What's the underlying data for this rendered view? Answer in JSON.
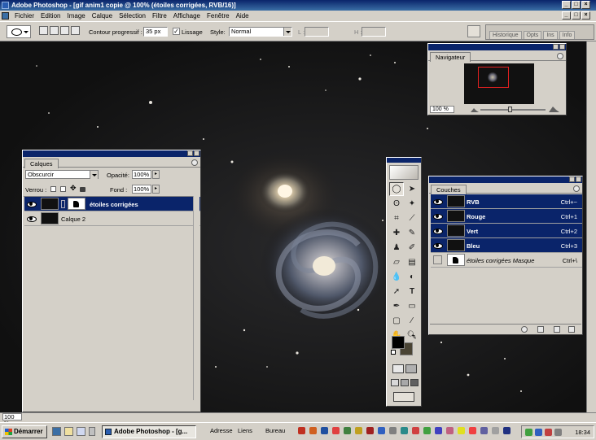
{
  "window": {
    "title": "Adobe Photoshop - [gif anim1 copie @ 100% (étoiles corrigées, RVB/16)]"
  },
  "menu": [
    "Fichier",
    "Edition",
    "Image",
    "Calque",
    "Sélection",
    "Filtre",
    "Affichage",
    "Fenêtre",
    "Aide"
  ],
  "options": {
    "feather_label": "Contour progressif :",
    "feather_value": "35 px",
    "lissage_label": "Lissage",
    "lissage_checked": "✓",
    "style_label": "Style:",
    "style_value": "Normal",
    "l_label": "L :",
    "h_label": "H :",
    "well_tabs": [
      "Historique",
      "Opts",
      "Ins",
      "Info"
    ]
  },
  "navigator": {
    "tab": "Navigateur",
    "zoom": "100 %"
  },
  "layers": {
    "tab": "Calques",
    "blend_mode": "Obscurcir",
    "opacity_label": "Opacité:",
    "opacity_value": "100%",
    "lock_label": "Verrou :",
    "fill_label": "Fond :",
    "fill_value": "100%",
    "rows": [
      {
        "name": "étoiles corrigées",
        "selected": true
      },
      {
        "name": "Calque 2",
        "selected": false
      }
    ]
  },
  "channels": {
    "tab": "Couches",
    "rows": [
      {
        "name": "RVB",
        "shortcut": "Ctrl+~",
        "selected": true
      },
      {
        "name": "Rouge",
        "shortcut": "Ctrl+1",
        "selected": true
      },
      {
        "name": "Vert",
        "shortcut": "Ctrl+2",
        "selected": true
      },
      {
        "name": "Bleu",
        "shortcut": "Ctrl+3",
        "selected": true
      },
      {
        "name": "étoiles corrigées Masque",
        "shortcut": "Ctrl+\\",
        "selected": false
      }
    ]
  },
  "status": {
    "zoom": "100 %"
  },
  "taskbar": {
    "start": "Démarrer",
    "task": "Adobe Photoshop - [g...",
    "address": "Adresse",
    "links": "Liens",
    "desktop": "Bureau",
    "clock": "18:34"
  },
  "colors": {
    "accent": "#0a246a",
    "chrome": "#d4d0c8",
    "workspace": "#141414"
  }
}
